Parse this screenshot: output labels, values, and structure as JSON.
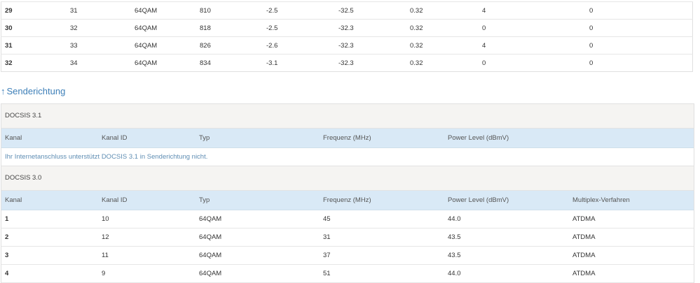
{
  "downstream_rows": [
    [
      "29",
      "31",
      "64QAM",
      "810",
      "-2.5",
      "-32.5",
      "0.32",
      "4",
      "0"
    ],
    [
      "30",
      "32",
      "64QAM",
      "818",
      "-2.5",
      "-32.3",
      "0.32",
      "0",
      "0"
    ],
    [
      "31",
      "33",
      "64QAM",
      "826",
      "-2.6",
      "-32.3",
      "0.32",
      "4",
      "0"
    ],
    [
      "32",
      "34",
      "64QAM",
      "834",
      "-3.1",
      "-32.3",
      "0.32",
      "0",
      "0"
    ]
  ],
  "upstream_link": {
    "arrow": "↑",
    "label": "Senderichtung"
  },
  "docsis31": {
    "title": "DOCSIS 3.1",
    "headers": [
      "Kanal",
      "Kanal ID",
      "Typ",
      "Frequenz (MHz)",
      "Power Level (dBmV)"
    ],
    "notice": "Ihr Internetanschluss unterstützt DOCSIS 3.1 in Senderichtung nicht."
  },
  "docsis30": {
    "title": "DOCSIS 3.0",
    "headers": [
      "Kanal",
      "Kanal ID",
      "Typ",
      "Frequenz (MHz)",
      "Power Level (dBmV)",
      "Multiplex-Verfahren"
    ],
    "rows": [
      [
        "1",
        "10",
        "64QAM",
        "45",
        "44.0",
        "ATDMA"
      ],
      [
        "2",
        "12",
        "64QAM",
        "31",
        "43.5",
        "ATDMA"
      ],
      [
        "3",
        "11",
        "64QAM",
        "37",
        "43.5",
        "ATDMA"
      ],
      [
        "4",
        "9",
        "64QAM",
        "51",
        "44.0",
        "ATDMA"
      ]
    ]
  },
  "colors": {
    "link": "#3d7fb8",
    "header_bg": "#d9e9f6",
    "group_bg": "#f5f4f2",
    "notice": "#5e8db3"
  }
}
